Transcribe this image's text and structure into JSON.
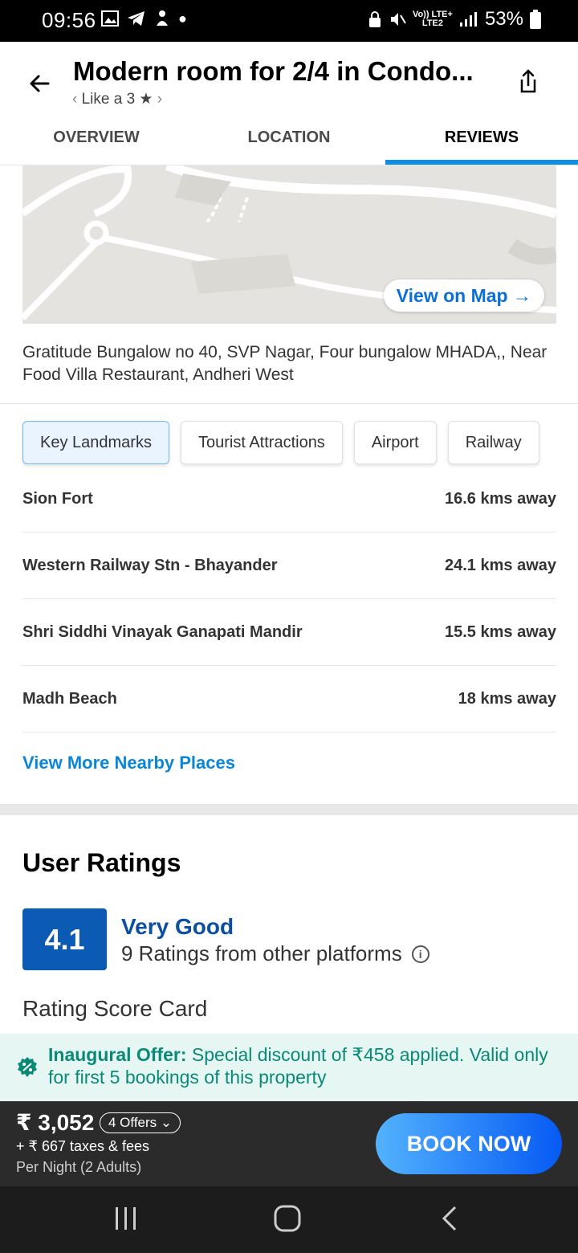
{
  "status_bar": {
    "time": "09:56",
    "network": "Vo)) LTE+",
    "network2": "LTE2",
    "battery": "53%"
  },
  "header": {
    "title": "Modern room for 2/4 in Condo...",
    "subtitle": "Like a 3 ★",
    "tabs": [
      "OVERVIEW",
      "LOCATION",
      "REVIEWS"
    ],
    "active_tab": "REVIEWS"
  },
  "map": {
    "button_label": "View on Map →"
  },
  "address": "Gratitude Bungalow no 40, SVP Nagar, Four bungalow MHADA,, Near Food Villa Restaurant, Andheri West",
  "chips": [
    "Key Landmarks",
    "Tourist Attractions",
    "Airport",
    "Railway"
  ],
  "landmarks": [
    {
      "name": "Sion Fort",
      "distance": "16.6 kms away"
    },
    {
      "name": "Western Railway Stn - Bhayander",
      "distance": "24.1 kms away"
    },
    {
      "name": "Shri Siddhi Vinayak Ganapati Mandir",
      "distance": "15.5 kms away"
    },
    {
      "name": "Madh Beach",
      "distance": "18 kms away"
    }
  ],
  "more_link": "View More Nearby Places",
  "ratings": {
    "title": "User Ratings",
    "score": "4.1",
    "label": "Very Good",
    "sub": "9 Ratings from other platforms",
    "scorecard": "Rating Score Card"
  },
  "offer": {
    "bold": "Inaugural Offer:",
    "text": " Special discount of ₹458 applied. Valid only for first 5 bookings of this property"
  },
  "booking": {
    "price": "₹ 3,052",
    "offers": "4 Offers",
    "taxes": "+ ₹ 667 taxes & fees",
    "per_night": "Per Night (2 Adults)",
    "book_label": "BOOK NOW"
  },
  "colors": {
    "accent": "#0a8ee6",
    "rating": "#0b5bb5",
    "offer_text": "#0a8a76",
    "book_start": "#53b2fe",
    "book_end": "#065af3"
  }
}
